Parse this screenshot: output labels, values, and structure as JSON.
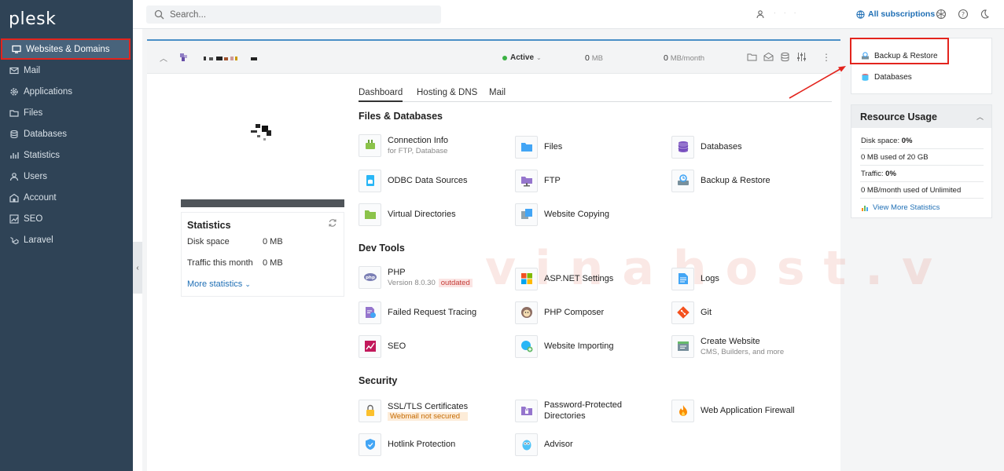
{
  "sidebar": {
    "logo": "plesk",
    "items": [
      {
        "label": "Websites & Domains",
        "icon": "monitor-icon"
      },
      {
        "label": "Mail",
        "icon": "mail-icon"
      },
      {
        "label": "Applications",
        "icon": "gear-icon"
      },
      {
        "label": "Files",
        "icon": "folder-icon"
      },
      {
        "label": "Databases",
        "icon": "database-icon"
      },
      {
        "label": "Statistics",
        "icon": "chart-icon"
      },
      {
        "label": "Users",
        "icon": "user-icon"
      },
      {
        "label": "Account",
        "icon": "account-icon"
      },
      {
        "label": "SEO",
        "icon": "seo-icon"
      },
      {
        "label": "Laravel",
        "icon": "laravel-icon"
      }
    ]
  },
  "topbar": {
    "search_placeholder": "Search...",
    "all_subscriptions": "All subscriptions"
  },
  "domain": {
    "status": "Active",
    "disk": "0",
    "disk_unit": "MB",
    "traffic": "0",
    "traffic_unit": "MB/month"
  },
  "statistics": {
    "title": "Statistics",
    "disk_label": "Disk space",
    "disk_value": "0 MB",
    "traffic_label": "Traffic this month",
    "traffic_value": "0 MB",
    "more": "More statistics"
  },
  "tabs": [
    "Dashboard",
    "Hosting & DNS",
    "Mail"
  ],
  "sections": {
    "files": "Files & Databases",
    "dev": "Dev Tools",
    "security": "Security"
  },
  "tools": {
    "connection_info": "Connection Info",
    "connection_info_sub": "for FTP, Database",
    "files": "Files",
    "databases": "Databases",
    "odbc": "ODBC Data Sources",
    "ftp": "FTP",
    "backup": "Backup & Restore",
    "virtual_dirs": "Virtual Directories",
    "website_copying": "Website Copying",
    "php": "PHP",
    "php_version": "Version 8.0.30",
    "php_badge": "outdated",
    "aspnet": "ASP.NET Settings",
    "logs": "Logs",
    "failed_request": "Failed Request Tracing",
    "php_composer": "PHP Composer",
    "git": "Git",
    "seo": "SEO",
    "website_importing": "Website Importing",
    "create_website": "Create Website",
    "create_website_sub": "CMS, Builders, and more",
    "ssl": "SSL/TLS Certificates",
    "ssl_badge": "Webmail not secured",
    "password_dirs_1": "Password-Protected",
    "password_dirs_2": "Directories",
    "waf": "Web Application Firewall",
    "hotlink": "Hotlink Protection",
    "advisor": "Advisor"
  },
  "watermark": "vinahost.v",
  "right": {
    "backup": "Backup & Restore",
    "databases": "Databases",
    "resource_title": "Resource Usage",
    "disk_label": "Disk space:",
    "disk_pct": "0%",
    "disk_detail": "0 MB used of 20 GB",
    "traffic_label": "Traffic:",
    "traffic_pct": "0%",
    "traffic_detail": "0 MB/month used of Unlimited",
    "view_more": "View More Statistics"
  },
  "colors": {
    "sidebar": "#2f4356",
    "accent": "#1f6fb5",
    "highlight": "#e3241d",
    "active_dot": "#3bb143"
  }
}
